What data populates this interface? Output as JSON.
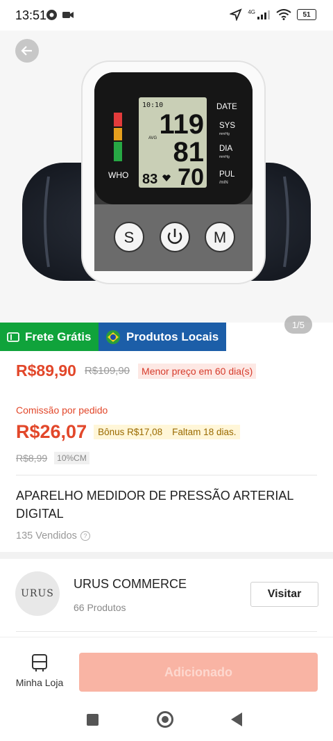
{
  "status_bar": {
    "time": "13:51",
    "network": "4G",
    "battery": "51"
  },
  "hero": {
    "image_icon": "blood-pressure-monitor",
    "device": {
      "sys": "119",
      "dia": "81",
      "pul": "70",
      "pulse_small": "83",
      "clock": "10:10",
      "avg": "AVG",
      "who": "WHO",
      "labels": [
        "DATE",
        "SYS",
        "mmHg",
        "DIA",
        "mmHg",
        "PUL",
        "/mIN"
      ],
      "buttons": [
        "S",
        "M"
      ]
    },
    "page_indicator": "1/5"
  },
  "badges": {
    "free_shipping": "Frete Grátis",
    "local_products": "Produtos Locais"
  },
  "price": {
    "current": "R$89,90",
    "original": "R$109,90",
    "lowest_tag": "Menor preço em 60 dia(s)"
  },
  "commission": {
    "label": "Comissão por pedido",
    "value": "R$26,07",
    "bonus": "Bônus R$17,08",
    "days_left": "Faltam 18 dias.",
    "old_value": "R$8,99",
    "rate": "10%CM"
  },
  "product": {
    "title": "APARELHO MEDIDOR DE PRESSÃO ARTERIAL DIGITAL",
    "sold": "135 Vendidos"
  },
  "shop": {
    "logo_text": "URUS",
    "name": "URUS COMMERCE",
    "count": "66 Produtos",
    "visit_label": "Visitar"
  },
  "bottom": {
    "my_store": "Minha Loja",
    "add_label": "Adicionado"
  },
  "colors": {
    "accent": "#e2472a",
    "free_green": "#10a33b",
    "local_blue": "#1c5ea8",
    "add_button": "#f9b4a4"
  }
}
